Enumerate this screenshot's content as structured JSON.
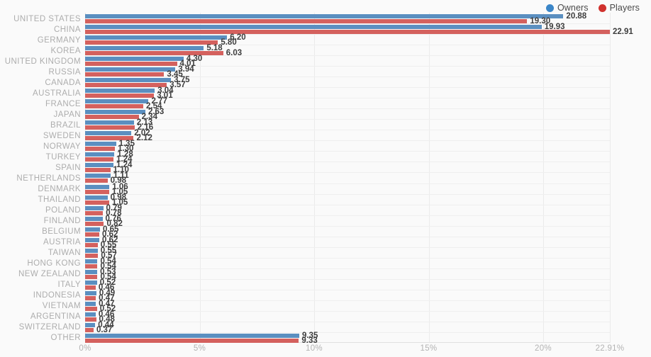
{
  "legend": {
    "position": "top-right",
    "items": [
      {
        "label": "Owners",
        "color": "#3b86c8",
        "icon": "circle-icon"
      },
      {
        "label": "Players",
        "color": "#d0312d",
        "icon": "circle-icon"
      }
    ]
  },
  "colors": {
    "owners_bar": "#5b8fc0",
    "players_bar": "#d4615e",
    "background": "#fafafa",
    "gridline": "#ebebeb",
    "category_label": "#adadad",
    "value_label": "#3d3d3d",
    "tick_label": "#b3b3b3"
  },
  "chart_data": {
    "type": "bar",
    "orientation": "horizontal",
    "title": "",
    "subtitle": "",
    "xlabel": "",
    "ylabel": "",
    "xlim": [
      0,
      22.91
    ],
    "grid": true,
    "legend_position": "top-right",
    "value_format": "percent",
    "xticks": [
      "0%",
      "5%",
      "10%",
      "15%",
      "20%",
      "22.91%"
    ],
    "xtick_values": [
      0,
      5,
      10,
      15,
      20,
      22.91
    ],
    "categories": [
      "UNITED STATES",
      "CHINA",
      "GERMANY",
      "KOREA",
      "UNITED KINGDOM",
      "RUSSIA",
      "CANADA",
      "AUSTRALIA",
      "FRANCE",
      "JAPAN",
      "BRAZIL",
      "SWEDEN",
      "NORWAY",
      "TURKEY",
      "SPAIN",
      "NETHERLANDS",
      "DENMARK",
      "THAILAND",
      "POLAND",
      "FINLAND",
      "BELGIUM",
      "AUSTRIA",
      "TAIWAN",
      "HONG KONG",
      "NEW ZEALAND",
      "ITALY",
      "INDONESIA",
      "VIETNAM",
      "ARGENTINA",
      "SWITZERLAND",
      "OTHER"
    ],
    "series": [
      {
        "name": "Owners",
        "color": "#5b8fc0",
        "values": [
          20.88,
          19.93,
          6.2,
          5.18,
          4.3,
          3.94,
          3.75,
          3.04,
          2.77,
          2.63,
          2.13,
          2.02,
          1.35,
          1.28,
          1.24,
          1.11,
          1.06,
          0.98,
          0.79,
          0.76,
          0.65,
          0.62,
          0.55,
          0.54,
          0.53,
          0.52,
          0.49,
          0.47,
          0.46,
          0.44,
          9.35
        ],
        "labels": [
          "20.88",
          "19.93",
          "6.20",
          "5.18",
          "4.30",
          "3.94",
          "3.75",
          "3.04",
          "2.77",
          "2.63",
          "2.13",
          "2.02",
          "1.35",
          "1.28",
          "1.24",
          "1.11",
          "1.06",
          "0.98",
          "0.79",
          "0.76",
          "0.65",
          "0.62",
          "0.55",
          "0.54",
          "0.53",
          "0.52",
          "0.49",
          "0.47",
          "0.46",
          "0.44",
          "9.35"
        ]
      },
      {
        "name": "Players",
        "color": "#d4615e",
        "values": [
          19.3,
          22.91,
          5.8,
          6.03,
          4.01,
          3.45,
          3.57,
          3.01,
          2.54,
          2.34,
          2.16,
          2.12,
          1.3,
          1.24,
          1.1,
          0.98,
          1.05,
          1.05,
          0.78,
          0.82,
          0.62,
          0.55,
          0.57,
          0.54,
          0.54,
          0.46,
          0.47,
          0.52,
          0.48,
          0.37,
          9.33
        ],
        "labels": [
          "19.30",
          "22.91",
          "5.80",
          "6.03",
          "4.01",
          "3.45",
          "3.57",
          "3.01",
          "2.54",
          "2.34",
          "2.16",
          "2.12",
          "1.30",
          "1.24",
          "1.10",
          "0.98",
          "1.05",
          "1.05",
          "0.78",
          "0.82",
          "0.62",
          "0.55",
          "0.57",
          "0.54",
          "0.54",
          "0.46",
          "0.47",
          "0.52",
          "0.48",
          "0.37",
          "9.33"
        ]
      }
    ]
  }
}
